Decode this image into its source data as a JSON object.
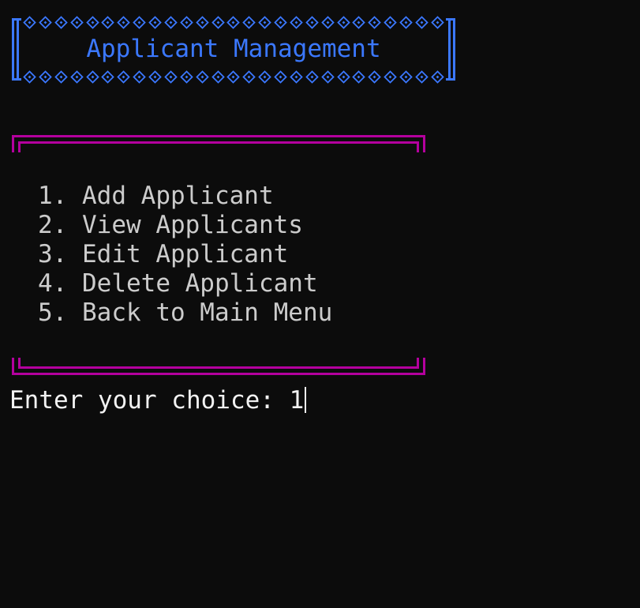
{
  "header": {
    "title": "Applicant Management",
    "border_color": "#3b78ff",
    "ornament_icon": "diamond-replacement-glyph-icon"
  },
  "menu": {
    "frame_color": "#b4009e",
    "items": [
      {
        "number": "1.",
        "label": "Add Applicant"
      },
      {
        "number": "2.",
        "label": "View Applicants"
      },
      {
        "number": "3.",
        "label": "Edit Applicant"
      },
      {
        "number": "4.",
        "label": "Delete Applicant"
      },
      {
        "number": "5.",
        "label": "Back to Main Menu"
      }
    ]
  },
  "prompt": {
    "label": "Enter your choice: ",
    "value": "1"
  },
  "colors": {
    "background": "#0c0c0c",
    "text": "#cccccc",
    "input_text": "#f2f2f2"
  }
}
